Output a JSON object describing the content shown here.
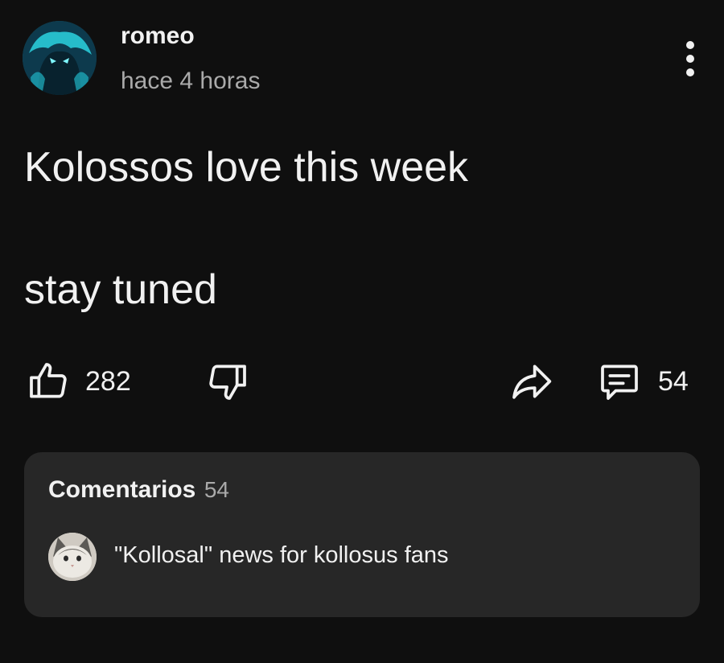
{
  "post": {
    "author": "romeo",
    "timestamp": "hace 4 horas",
    "lines": [
      "Kolossos love this week",
      "stay tuned"
    ]
  },
  "actions": {
    "likes": "282",
    "comments": "54"
  },
  "comments_panel": {
    "title": "Comentarios",
    "count": "54",
    "preview_text": "\"Kollosal\" news for kollosus fans"
  },
  "icons": {
    "more": "more-vertical-icon",
    "like": "thumbs-up-icon",
    "dislike": "thumbs-down-icon",
    "share": "share-arrow-icon",
    "comment": "comment-bubble-icon"
  },
  "colors": {
    "background": "#0f0f0f",
    "card": "#272727",
    "text": "#f1f1f1",
    "secondary_text": "#aaaaaa"
  }
}
